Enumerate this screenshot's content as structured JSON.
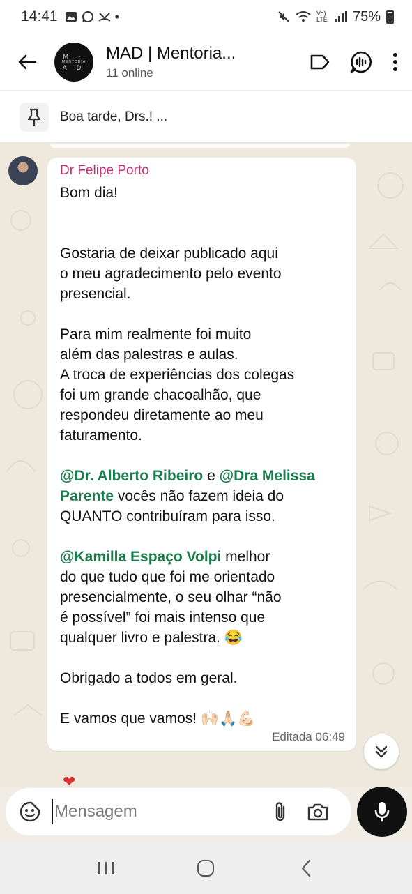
{
  "status_bar": {
    "time": "14:41",
    "battery": "75%",
    "network_badge": "Vo) LTE"
  },
  "header": {
    "title": "MAD | Mentoria...",
    "subtitle": "11 online",
    "avatar_text": "MENTORIA"
  },
  "pinned": {
    "text": "Boa tarde, Drs.! ..."
  },
  "message": {
    "sender": "Dr Felipe Porto",
    "greeting": "Bom dia!",
    "para1": "Gostaria de deixar publicado aqui\no meu agradecimento pelo evento\npresencial.",
    "para2": "Para mim realmente foi muito\nalém das palestras e aulas.\nA troca de experiências dos colegas\nfoi um grande chacoalhão, que\nrespondeu diretamente ao meu\nfaturamento.",
    "mention1": "@Dr. Alberto Ribeiro",
    "connector": " e ",
    "mention2": "@Dra Melissa Parente",
    "para3_rest": " vocês não fazem ideia do\nQUANTO contribuíram para isso.",
    "mention3": "@Kamilla Espaço Volpi",
    "para4_rest": " melhor\ndo que tudo que foi me orientado\npresencialmente, o seu olhar “não\né possível” foi mais intenso que\nqualquer livro e palestra. 😂",
    "para5": "Obrigado a todos em geral.",
    "para6": "E vamos que vamos! 🙌🏻🙏🏻💪🏻",
    "meta": "Editada 06:49",
    "reaction": "❤"
  },
  "composer": {
    "placeholder": "Mensagem"
  },
  "icons": {
    "back": "arrow-left-icon",
    "label": "label-tag-icon",
    "call": "voice-chat-icon",
    "menu": "more-vertical-icon",
    "pin": "pin-icon",
    "emoji": "sticker-icon",
    "attach": "paperclip-icon",
    "camera": "camera-icon",
    "mic": "microphone-icon",
    "scroll": "double-chevron-down-icon"
  }
}
